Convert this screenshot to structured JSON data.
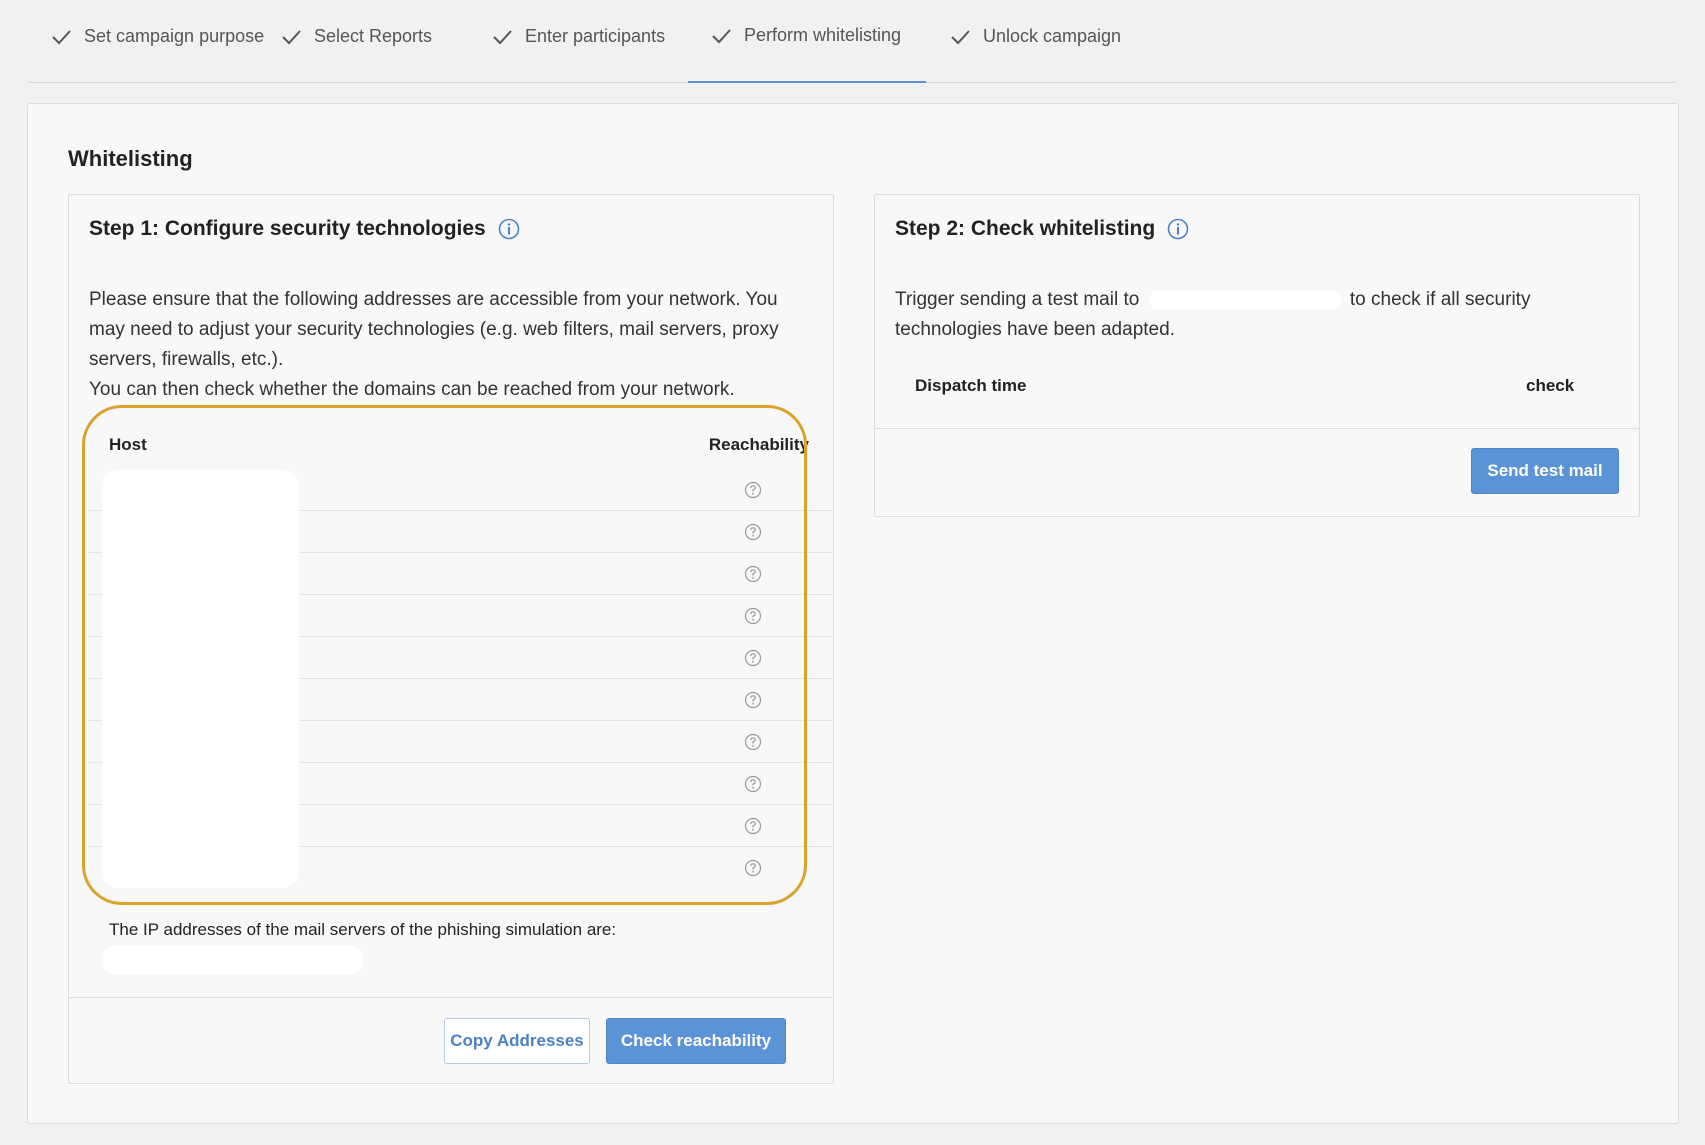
{
  "stepper": {
    "steps": [
      {
        "label": "Set campaign purpose"
      },
      {
        "label": "Select Reports"
      },
      {
        "label": "Enter participants"
      },
      {
        "label": "Perform whitelisting"
      },
      {
        "label": "Unlock campaign"
      }
    ],
    "active_step": "Perform whitelisting"
  },
  "page": {
    "title": "Whitelisting"
  },
  "step1": {
    "title": "Step 1: Configure security technologies",
    "desc_line1": "Please ensure that the following addresses are accessible from your network. You",
    "desc_line2": "may need to adjust your security technologies (e.g. web filters, mail servers, proxy",
    "desc_line3": "servers, firewalls, etc.).",
    "desc_line4": "You can then check whether the domains can be reached from your network.",
    "table": {
      "col_host": "Host",
      "col_reachability": "Reachability",
      "row_count": 10,
      "reachability_icon": "question-circle-icon"
    },
    "ip_label": "The IP addresses of the mail servers of the phishing simulation are:",
    "copy_button": "Copy Addresses",
    "check_button": "Check reachability"
  },
  "step2": {
    "title": "Step 2: Check whitelisting",
    "desc_part1": "Trigger sending a test mail to",
    "desc_part2": "to check if all security",
    "desc_line2": "technologies have been adapted.",
    "col_dispatch": "Dispatch time",
    "col_check": "check",
    "send_button": "Send test mail"
  },
  "colors": {
    "accent": "#5b93d6",
    "highlight": "#d9a22a"
  }
}
